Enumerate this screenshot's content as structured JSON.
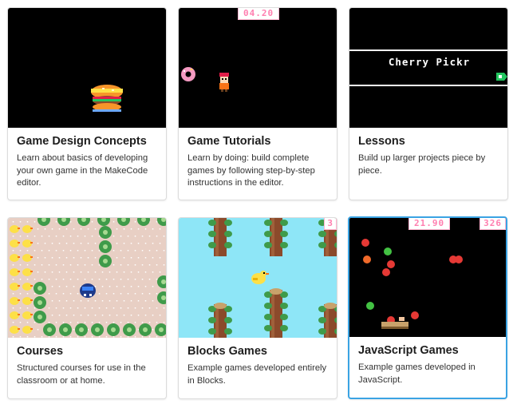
{
  "cards": [
    {
      "title": "Game Design Concepts",
      "description": "Learn about basics of developing your own game in the MakeCode editor."
    },
    {
      "title": "Game Tutorials",
      "description": "Learn by doing: build complete games by following step-by-step instructions in the editor.",
      "hud_score": "04.20"
    },
    {
      "title": "Lessons",
      "description": "Build up larger projects piece by piece.",
      "banner_text": "Cherry Pickr"
    },
    {
      "title": "Courses",
      "description": "Structured courses for use in the classroom or at home."
    },
    {
      "title": "Blocks Games",
      "description": "Example games developed entirely in Blocks.",
      "hud_score": "3"
    },
    {
      "title": "JavaScript Games",
      "description": "Example games developed in JavaScript.",
      "hud_timer": "21.90",
      "hud_score": "326"
    }
  ],
  "colors": {
    "selected_border": "#3aa3e3",
    "hud_pink": "#ff7fb0",
    "sky": "#8ee6f7"
  },
  "icons": [
    "burger-sprite",
    "donut-sprite",
    "character-sprite",
    "duck-sprite",
    "tree-sprite",
    "pipe-sprite",
    "basket-sprite"
  ]
}
